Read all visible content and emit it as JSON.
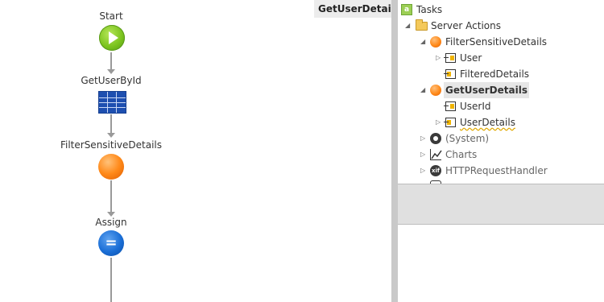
{
  "editor": {
    "tab_title": "GetUserDetails"
  },
  "flow": {
    "nodes": [
      {
        "label": "Start",
        "type": "start",
        "icon": "play-icon"
      },
      {
        "label": "GetUserById",
        "type": "aggregate",
        "icon": "aggregate-table-icon"
      },
      {
        "label": "FilterSensitiveDetails",
        "type": "server-action",
        "icon": "server-action-icon"
      },
      {
        "label": "Assign",
        "type": "assign",
        "icon": "assign-icon"
      }
    ]
  },
  "tree": {
    "items": [
      {
        "label": "Tasks",
        "icon": "tasks-icon",
        "expander": ""
      },
      {
        "label": "Server Actions",
        "icon": "folder-icon",
        "expander": "expanded"
      },
      {
        "label": "FilterSensitiveDetails",
        "icon": "server-action-icon",
        "expander": "expanded"
      },
      {
        "label": "User",
        "icon": "input-parameter-icon",
        "expander": "collapsed"
      },
      {
        "label": "FilteredDetails",
        "icon": "output-parameter-icon",
        "expander": ""
      },
      {
        "label": "GetUserDetails",
        "icon": "server-action-icon",
        "expander": "expanded",
        "selected": true
      },
      {
        "label": "UserId",
        "icon": "input-parameter-icon",
        "expander": ""
      },
      {
        "label": "UserDetails",
        "icon": "output-parameter-icon",
        "expander": "collapsed",
        "warning": true
      },
      {
        "label": "(System)",
        "icon": "system-module-icon",
        "expander": "collapsed"
      },
      {
        "label": "Charts",
        "icon": "charts-module-icon",
        "expander": "collapsed"
      },
      {
        "label": "HTTPRequestHandler",
        "icon": "xif-module-icon",
        "expander": "collapsed"
      }
    ]
  },
  "colors": {
    "start": "#7cc41f",
    "server_action": "#ff8a1a",
    "assign": "#1a6ed6",
    "aggregate": "#1e4fb0",
    "selection": "#e6e6e6"
  }
}
